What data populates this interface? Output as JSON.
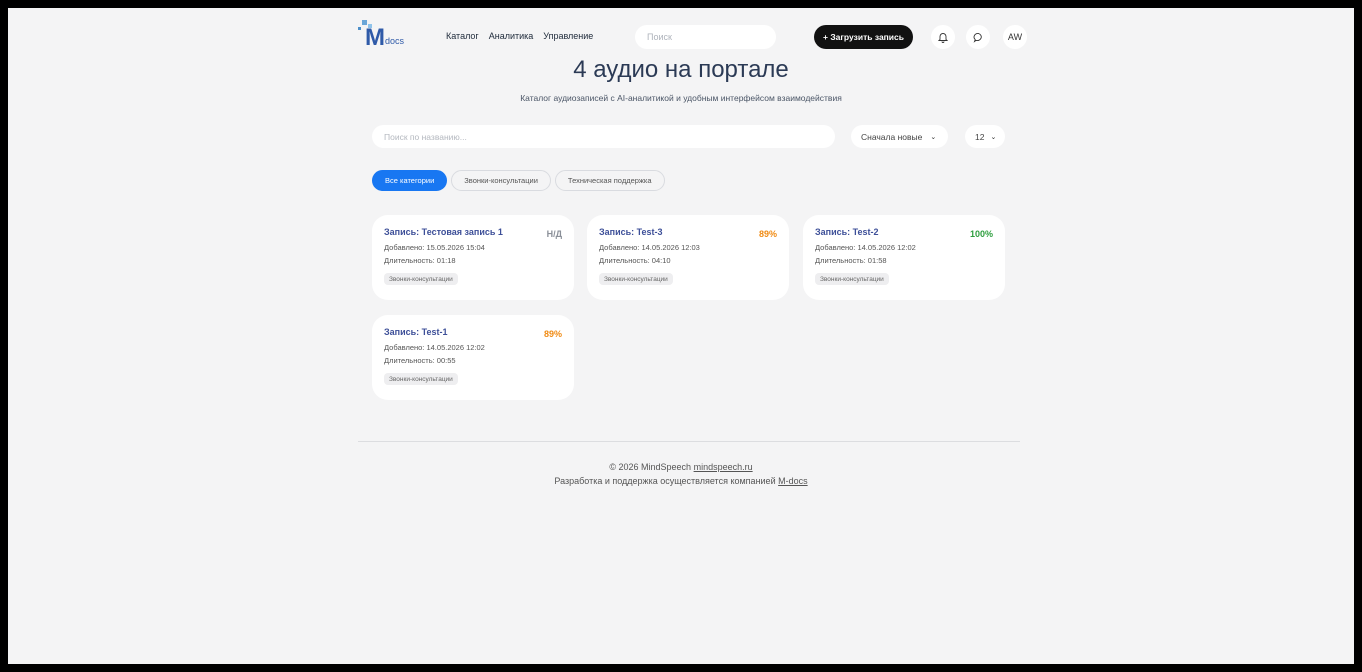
{
  "header": {
    "logo_text": "M",
    "logo_sub": "docs",
    "nav": [
      "Каталог",
      "Аналитика",
      "Управление"
    ],
    "search_placeholder": "Поиск",
    "upload_label": "+ Загрузить запись",
    "avatar": "AW"
  },
  "hero": {
    "title": "4 аудио на портале",
    "subtitle": "Каталог аудиозаписей с AI-аналитикой и удобным интерфейсом взаимодействия"
  },
  "filters": {
    "name_search_placeholder": "Поиск по названию...",
    "sort_value": "Сначала новые",
    "page_size_value": "12",
    "categories": [
      "Все категории",
      "Звонки-консультации",
      "Техническая поддержка"
    ]
  },
  "records": [
    {
      "title": "Запись: Тестовая запись 1",
      "score": "Н/Д",
      "score_color": "#8a8f98",
      "added": "Добавлено: 15.05.2026 15:04",
      "duration": "Длительность: 01:18",
      "tag": "Звонки-консультации"
    },
    {
      "title": "Запись: Test-3",
      "score": "89%",
      "score_color": "#f08a12",
      "added": "Добавлено: 14.05.2026 12:03",
      "duration": "Длительность: 04:10",
      "tag": "Звонки-консультации"
    },
    {
      "title": "Запись: Test-2",
      "score": "100%",
      "score_color": "#2e9e3e",
      "added": "Добавлено: 14.05.2026 12:02",
      "duration": "Длительность: 01:58",
      "tag": "Звонки-консультации"
    },
    {
      "title": "Запись: Test-1",
      "score": "89%",
      "score_color": "#f08a12",
      "added": "Добавлено: 14.05.2026 12:02",
      "duration": "Длительность: 00:55",
      "tag": "Звонки-консультации"
    }
  ],
  "footer": {
    "copyright": "© 2026 MindSpeech",
    "copyright_link": "mindspeech.ru",
    "dev_text": "Разработка и поддержка осуществляется компанией",
    "dev_link": "M-docs"
  },
  "colors": {
    "accent": "#1877f2",
    "card_title": "#3d4f98",
    "background": "#f4f4f5"
  }
}
